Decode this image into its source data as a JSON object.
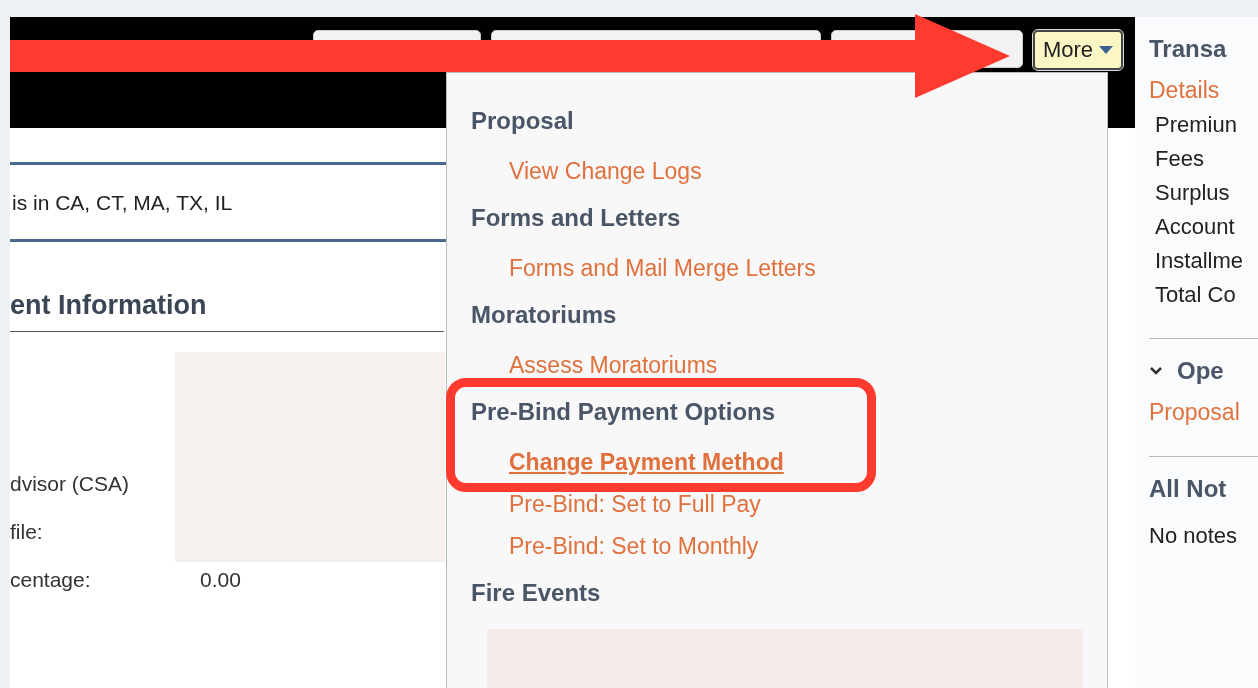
{
  "toolbar": {
    "buttons": [
      {
        "kind": "blank"
      },
      {
        "kind": "blank"
      },
      {
        "kind": "blank"
      }
    ],
    "more_button": {
      "label": "More",
      "expanded": true
    }
  },
  "notice": {
    "text": "is in CA, CT, MA, TX, IL"
  },
  "section": {
    "title": "ent Information",
    "fields": [
      {
        "label": "dvisor (CSA)"
      },
      {
        "label": "file:"
      },
      {
        "label": "centage:",
        "value": "0.00"
      }
    ]
  },
  "more_menu": {
    "groups": [
      {
        "title": "Proposal",
        "items": [
          {
            "label": "View Change Logs",
            "highlighted": false
          }
        ]
      },
      {
        "title": "Forms and Letters",
        "items": [
          {
            "label": "Forms and Mail Merge Letters",
            "highlighted": false
          }
        ]
      },
      {
        "title": "Moratoriums",
        "items": [
          {
            "label": "Assess Moratoriums",
            "highlighted": false
          }
        ]
      },
      {
        "title": "Pre-Bind Payment Options",
        "items": [
          {
            "label": "Change Payment Method",
            "highlighted": true
          },
          {
            "label": "Pre-Bind: Set to Full Pay",
            "highlighted": false
          },
          {
            "label": "Pre-Bind: Set to Monthly",
            "highlighted": false
          }
        ]
      },
      {
        "title": "Fire Events"
      }
    ]
  },
  "side_panel": {
    "title": "Transa",
    "link": "Details",
    "items": [
      "Premiun",
      "Fees",
      "Surplus",
      "Account",
      "Installme",
      "Total Co"
    ],
    "open_section": {
      "title": "Ope",
      "expanded": true,
      "link": "Proposal"
    },
    "notes": {
      "title": "All Not",
      "text": "No notes"
    }
  }
}
